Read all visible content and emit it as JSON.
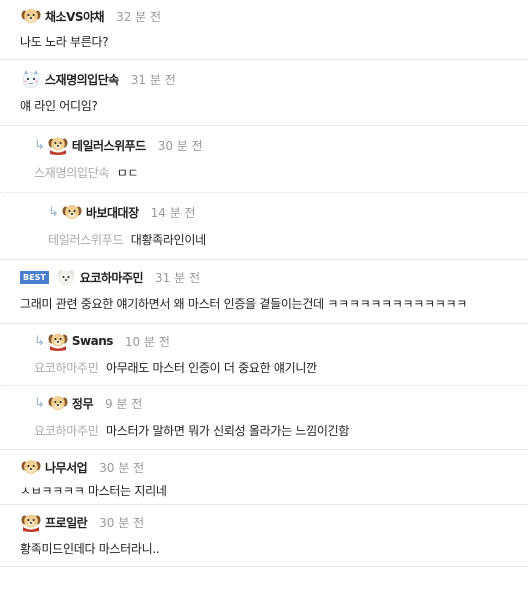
{
  "best_label": "BEST",
  "colors": {
    "best_badge": "#4a7fd0",
    "time": "#999999",
    "mention": "#aaaaaa"
  },
  "comments": [
    {
      "author": "채소VS야채",
      "time": "32 분 전",
      "text": "나도 노라 부른다?",
      "avatar": "dog-avatar-icon"
    },
    {
      "author": "스재명의입단속",
      "time": "31 분 전",
      "text": "얘 라인 어디임?",
      "avatar": "snow-creature-avatar-icon"
    },
    {
      "author": "테일러스위푸드",
      "time": "30 분 전",
      "mention": "스재명의입단속",
      "text": "ㅁㄷ",
      "avatar": "dog-red-scarf-avatar-icon"
    },
    {
      "author": "바보대대장",
      "time": "14 분 전",
      "mention": "테일러스위푸드",
      "text": "대황족라인이네",
      "avatar": "dog-avatar-icon"
    },
    {
      "author": "요코하마주민",
      "time": "31 분 전",
      "text": "그래미 관련 중요한 얘기하면서 왜 마스터 인증을 곁들이는건데 ㅋㅋㅋㅋㅋㅋㅋㅋㅋㅋㅋㅋㅋ",
      "avatar": "white-dog-avatar-icon",
      "best": true
    },
    {
      "author": "Swans",
      "time": "10 분 전",
      "mention": "요코하마주민",
      "text": "아무래도 마스터 인증이 더 중요한 얘기니깐",
      "avatar": "dog-red-scarf-avatar-icon"
    },
    {
      "author": "정무",
      "time": "9 분 전",
      "mention": "요코하마주민",
      "text": "마스터가 말하면 뭐가 신뢰성 올라가는 느낌이긴함",
      "avatar": "dog-avatar-icon"
    },
    {
      "author": "나무서업",
      "time": "30 분 전",
      "text": "ㅅㅂㅋㅋㅋㅋ 마스터는 지리네",
      "avatar": "dog-avatar-icon"
    },
    {
      "author": "프로일란",
      "time": "30 분 전",
      "text": "황족미드인데다 마스터라니..",
      "avatar": "dog-red-scarf-avatar-icon"
    }
  ]
}
